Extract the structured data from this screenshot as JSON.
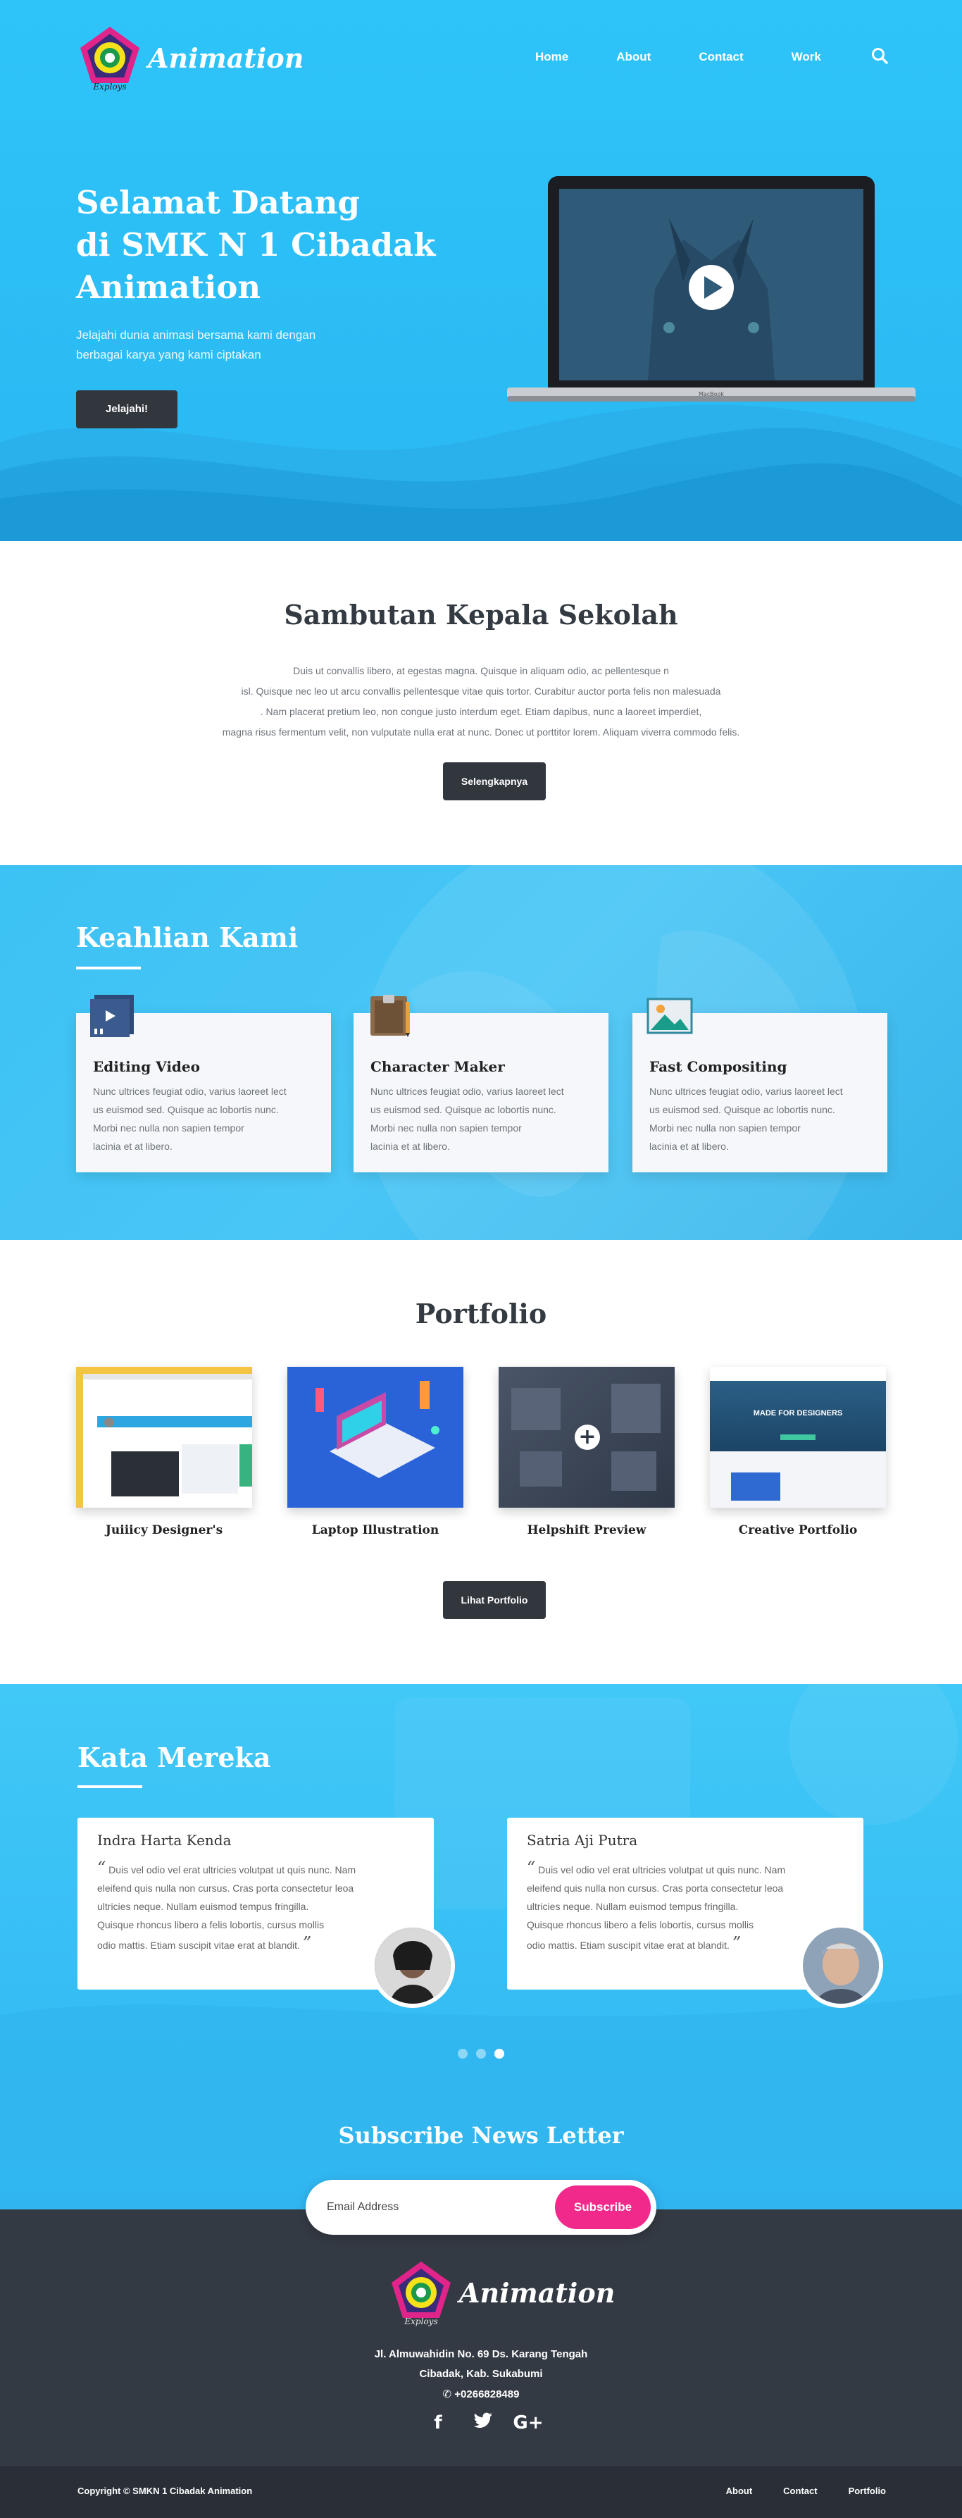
{
  "brand": {
    "name": "Animation",
    "tagline": "Exploys"
  },
  "nav": {
    "items": [
      "Home",
      "About",
      "Contact",
      "Work"
    ],
    "search_icon": "search-icon"
  },
  "hero": {
    "title_line1": "Selamat Datang",
    "title_line2": "di SMK N 1 Cibadak",
    "title_line3": "Animation",
    "subtitle_line1": "Jelajahi dunia animasi bersama kami dengan",
    "subtitle_line2": "berbagai karya yang kami ciptakan",
    "button": "Jelajahi!",
    "laptop_brand": "MacBook"
  },
  "sambutan": {
    "title": "Sambutan Kepala Sekolah",
    "lines": [
      "Duis ut convallis libero, at egestas magna. Quisque in aliquam odio, ac pellentesque n",
      "isl. Quisque nec leo ut arcu convallis pellentesque vitae quis tortor. Curabitur auctor porta felis non malesuada",
      ". Nam placerat pretium leo, non congue justo interdum eget. Etiam dapibus, nunc a laoreet imperdiet,",
      "magna risus fermentum velit, non vulputate nulla erat at nunc. Donec ut porttitor lorem. Aliquam viverra commodo felis."
    ],
    "button": "Selengkapnya"
  },
  "keahlian": {
    "title": "Keahlian Kami",
    "cards": [
      {
        "title": "Editing Video",
        "icon": "video-player-icon",
        "lines": [
          "Nunc ultrices feugiat odio, varius laoreet lect",
          "us euismod sed. Quisque ac lobortis nunc.",
          "Morbi nec nulla non sapien tempor",
          "lacinia et at libero."
        ]
      },
      {
        "title": "Character Maker",
        "icon": "sketchbook-icon",
        "lines": [
          "Nunc ultrices feugiat odio, varius laoreet lect",
          "us euismod sed. Quisque ac lobortis nunc.",
          "Morbi nec nulla non sapien tempor",
          "lacinia et at libero."
        ]
      },
      {
        "title": "Fast Compositing",
        "icon": "landscape-image-icon",
        "lines": [
          "Nunc ultrices feugiat odio, varius laoreet lect",
          "us euismod sed. Quisque ac lobortis nunc.",
          "Morbi nec nulla non sapien tempor",
          "lacinia et at libero."
        ]
      }
    ]
  },
  "portfolio": {
    "title": "Portfolio",
    "items": [
      "Juiiicy Designer's",
      "Laptop Illustration",
      "Helpshift Preview",
      "Creative Portfolio"
    ],
    "thumb_texts": {
      "made_for_designers": "MADE FOR DESIGNERS"
    },
    "button": "Lihat Portfolio"
  },
  "testimoni": {
    "title": "Kata Mereka",
    "items": [
      {
        "name": "Indra Harta Kenda",
        "lines": [
          "Duis vel odio vel erat ultricies volutpat ut quis nunc. Nam",
          "eleifend quis nulla non cursus. Cras porta consectetur leoa",
          "ultricies neque. Nullam euismod tempus fringilla.",
          "Quisque rhoncus libero a felis lobortis, cursus mollis",
          "odio mattis. Etiam suscipit vitae erat at blandit."
        ]
      },
      {
        "name": "Satria Aji Putra",
        "lines": [
          "Duis vel odio vel erat ultricies volutpat ut quis nunc. Nam",
          "eleifend quis nulla non cursus. Cras porta consectetur leoa",
          "ultricies neque. Nullam euismod tempus fringilla.",
          "Quisque rhoncus libero a felis lobortis, cursus mollis",
          "odio mattis. Etiam suscipit vitae erat at blandit."
        ]
      }
    ],
    "open_quote": "“",
    "close_quote": "”"
  },
  "subscribe": {
    "title": "Subscribe News Letter",
    "placeholder": "Email Address",
    "button": "Subscribe"
  },
  "footer": {
    "address_line1": "Jl. Almuwahidin No. 69 Ds. Karang Tengah",
    "address_line2": "Cibadak, Kab. Sukabumi",
    "phone": "+0266828489",
    "social": [
      "f",
      "🐦",
      "G+"
    ],
    "copyright": "Copyright © SMKN 1 Cibadak Animation",
    "links": [
      "About",
      "Contact",
      "Portfolio"
    ]
  },
  "colors": {
    "primary": "#2ec4f9",
    "dark": "#32373e",
    "accent": "#f0298a",
    "footer": "#343a43"
  }
}
